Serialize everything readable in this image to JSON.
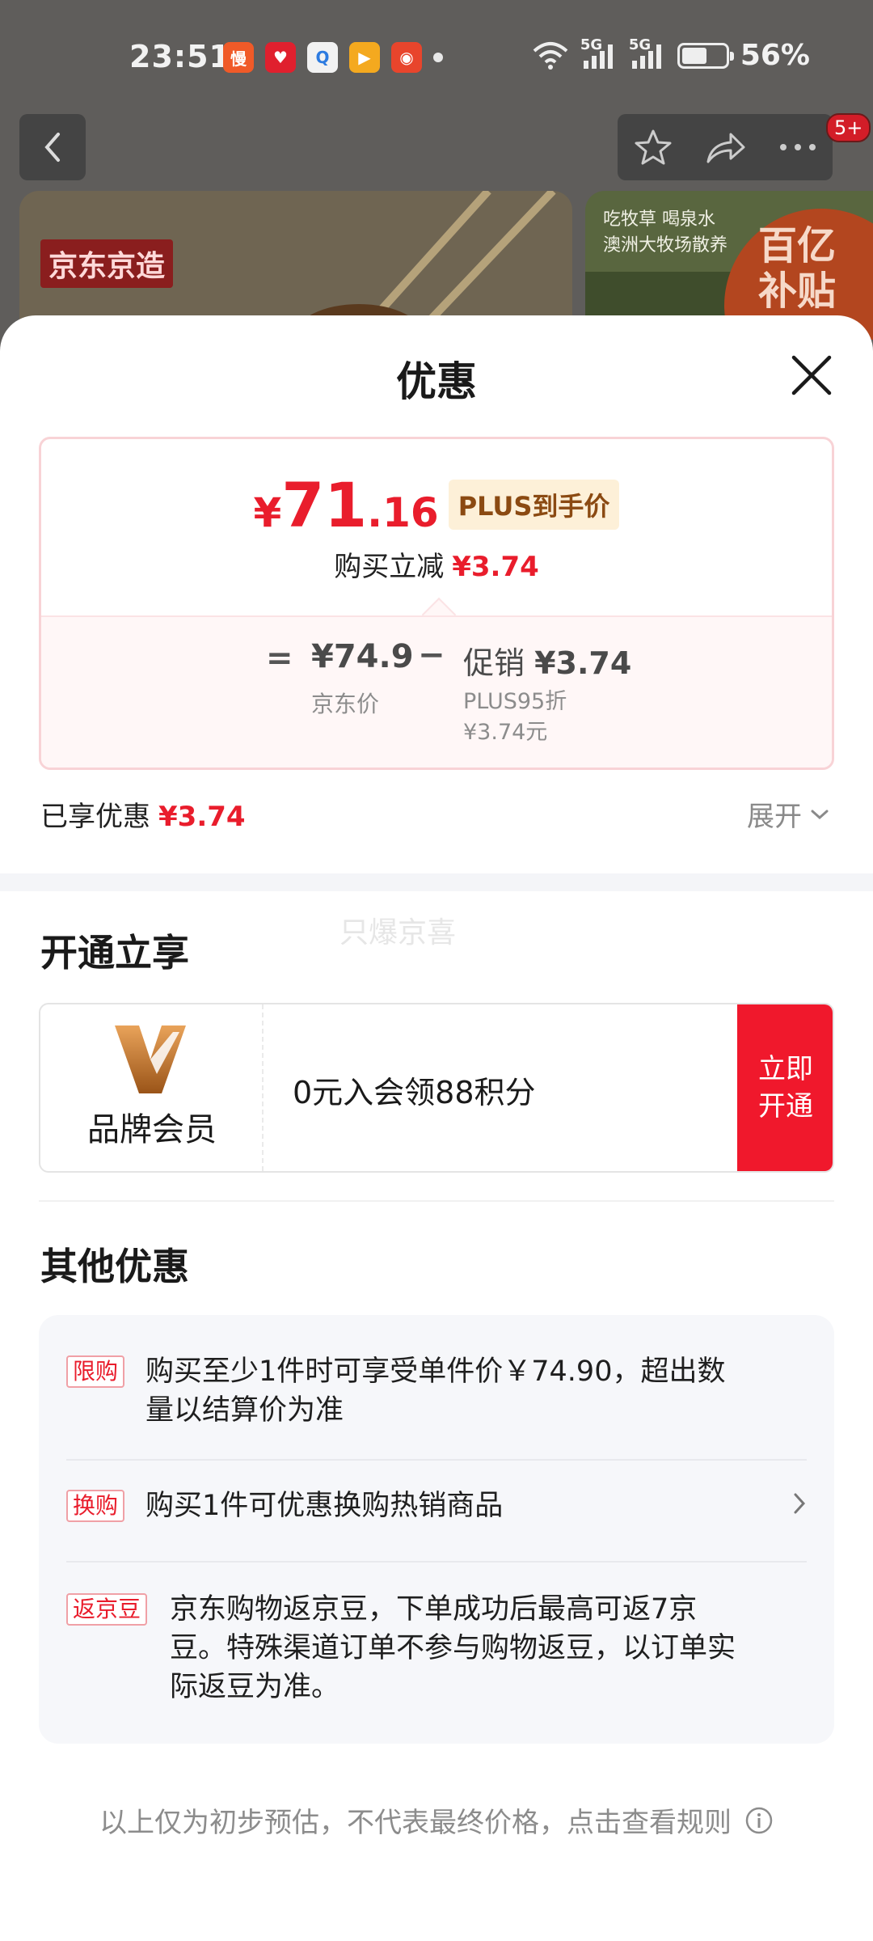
{
  "status_bar": {
    "time": "23:51",
    "apps": [
      {
        "icon": "jd-app-icon",
        "glyph": "慢",
        "color": "#f05a28"
      },
      {
        "icon": "heart-app-icon",
        "glyph": "♥",
        "color": "#e0202e"
      },
      {
        "icon": "search-app-icon",
        "glyph": "Q",
        "color": "#2d7be0"
      },
      {
        "icon": "video-app-icon",
        "glyph": "▶",
        "color": "#f4a91f"
      },
      {
        "icon": "shop-app-icon",
        "glyph": "◉",
        "color": "#e8452c"
      }
    ],
    "signal_1": "5G",
    "signal_2": "5G",
    "battery": "56%"
  },
  "background": {
    "badge_count": "5+",
    "jd_tag": "京东京造",
    "right_banner_text_1": "吃牧草 喝泉水",
    "right_banner_text_2": "澳洲大牧场散养",
    "subsidy_text_1": "百亿",
    "subsidy_text_2": "补贴"
  },
  "sheet": {
    "title": "优惠",
    "price": {
      "yen": "¥",
      "integer": "71",
      "decimal": ".16",
      "tag": "PLUS到手价",
      "reduce_label": "购买立减",
      "reduce_value": "¥3.74"
    },
    "breakdown": {
      "equals": "=",
      "jd_price": "¥74.9",
      "jd_price_label": "京东价",
      "minus": "−",
      "promo_label": "促销",
      "promo_value": "¥3.74",
      "promo_sub_1": "PLUS95折",
      "promo_sub_2": "¥3.74元"
    },
    "enjoyed_label": "已享优惠",
    "enjoyed_value": "¥3.74",
    "expand_label": "展开",
    "watermark": "只爆京喜",
    "open_section_title": "开通立享",
    "member": {
      "label": "品牌会员",
      "offer": "0元入会领88积分",
      "button_line1": "立即",
      "button_line2": "开通"
    },
    "other_section_title": "其他优惠",
    "offers": [
      {
        "tag": "限购",
        "line1": "购买至少1件时可享受单件价￥74.90，超出数",
        "line2": "量以结算价为准"
      },
      {
        "tag": "换购",
        "line1": "购买1件可优惠换购热销商品"
      },
      {
        "tag": "返京豆",
        "line1": "京东购物返京豆，下单成功后最高可返7京",
        "line2": "豆。特殊渠道订单不参与购物返豆，以订单实",
        "line3": "际返豆为准。"
      }
    ],
    "footer": "以上仅为初步预估，不代表最终价格，点击查看规则"
  }
}
